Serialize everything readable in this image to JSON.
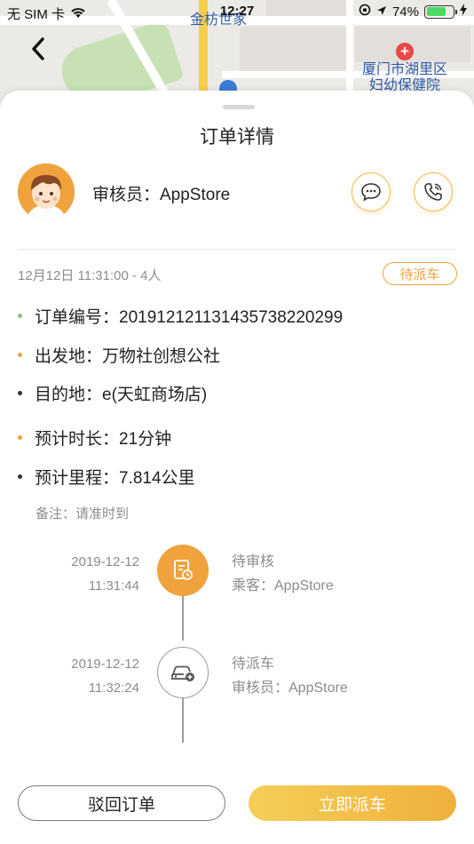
{
  "status_bar": {
    "carrier": "无 SIM 卡",
    "time": "12:27",
    "battery": "74%",
    "battery_level": 0.74
  },
  "map": {
    "labels": {
      "jinfang": "金枋世家",
      "hospital_line1": "厦门市湖里区",
      "hospital_line2": "妇幼保健院"
    }
  },
  "sheet": {
    "title": "订单详情",
    "reviewer_label": "审核员：AppStore",
    "order_time": "12月12日 11:31:00 - 4人",
    "status_tag": "待派车",
    "info": [
      {
        "text": "订单编号：20191212113143573822 0299",
        "color": "#8fbf7f"
      },
      {
        "text": "出发地：万物社创想公社",
        "color": "#f0a23c"
      },
      {
        "text": "目的地：e(天虹商场店)",
        "color": "#333333"
      },
      {
        "text": "预计时长：21分钟",
        "color": "#f0a23c"
      },
      {
        "text": "预计里程：7.814公里",
        "color": "#333333"
      }
    ],
    "remark": "备注：请准时到"
  },
  "timeline": [
    {
      "date": "2019-12-12",
      "time": "11:31:44",
      "status": "待审核",
      "actor": "乘客：AppStore",
      "icon": "document-clock-icon",
      "active": true
    },
    {
      "date": "2019-12-12",
      "time": "11:32:24",
      "status": "待派车",
      "actor": "审核员：AppStore",
      "icon": "car-plus-icon",
      "active": false
    }
  ],
  "buttons": {
    "reject": "驳回订单",
    "dispatch": "立即派车"
  },
  "colors": {
    "accent": "#f0a23c",
    "dispatch_gradient_start": "#f4cf57",
    "dispatch_gradient_end": "#f0b03c"
  }
}
